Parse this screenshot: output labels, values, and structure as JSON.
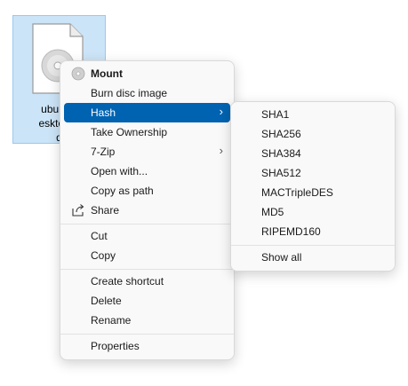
{
  "desktop_file": {
    "label_lines": [
      "ubuntu-",
      "esktop-a",
      "d"
    ]
  },
  "context_menu": {
    "items": [
      {
        "label": "Mount",
        "bold": true,
        "icon": "disc-icon"
      },
      {
        "label": "Burn disc image"
      },
      {
        "label": "Hash",
        "submenu": true,
        "highlighted": true
      },
      {
        "label": "Take Ownership"
      },
      {
        "label": "7-Zip",
        "submenu": true
      },
      {
        "label": "Open with..."
      },
      {
        "label": "Copy as path"
      },
      {
        "label": "Share",
        "icon": "share-icon"
      },
      {
        "label": "Cut"
      },
      {
        "label": "Copy"
      },
      {
        "label": "Create shortcut"
      },
      {
        "label": "Delete"
      },
      {
        "label": "Rename"
      },
      {
        "label": "Properties"
      }
    ]
  },
  "hash_submenu": {
    "items": [
      "SHA1",
      "SHA256",
      "SHA384",
      "SHA512",
      "MACTripleDES",
      "MD5",
      "RIPEMD160",
      "Show all"
    ]
  },
  "colors": {
    "highlight": "#0063b1",
    "selection_bg": "#cce4f7",
    "menu_bg": "#f9f9f9"
  }
}
